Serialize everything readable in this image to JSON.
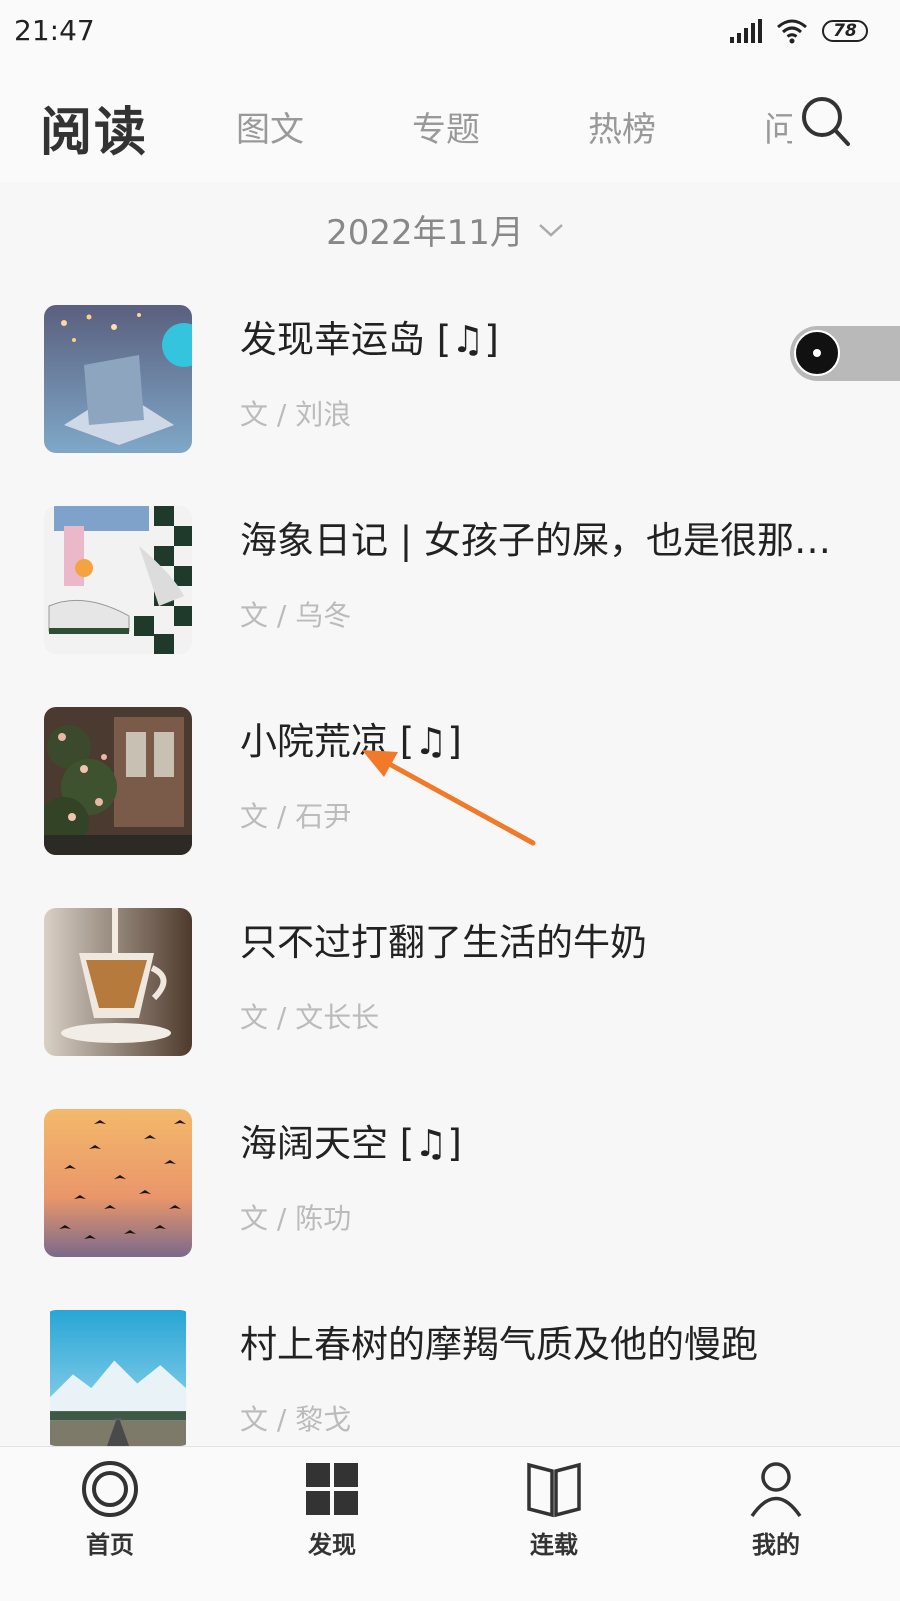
{
  "status_bar": {
    "time": "21:47",
    "battery": "78",
    "icons": [
      "signal-icon",
      "wifi-icon",
      "battery-icon"
    ]
  },
  "header": {
    "title": "阅读",
    "tabs": [
      {
        "label": "图文"
      },
      {
        "label": "专题"
      },
      {
        "label": "热榜"
      },
      {
        "label": "问"
      }
    ],
    "search_icon": "search-icon"
  },
  "month_selector": {
    "label": "2022年11月",
    "icon": "chevron-down-icon"
  },
  "articles": [
    {
      "title": "发现幸运岛 [♫]",
      "author": "文 / 刘浪"
    },
    {
      "title": "海象日记 | 女孩子的屎，也是很那…",
      "author": "文 / 乌冬"
    },
    {
      "title": "小院荒凉 [♫]",
      "author": "文 / 石尹"
    },
    {
      "title": "只不过打翻了生活的牛奶",
      "author": "文 / 文长长"
    },
    {
      "title": "海阔天空 [♫]",
      "author": "文 / 陈功"
    },
    {
      "title": "村上春树的摩羯气质及他的慢跑",
      "author": "文 / 黎戈"
    }
  ],
  "bottom_nav": [
    {
      "label": "首页",
      "icon": "home-icon"
    },
    {
      "label": "发现",
      "icon": "grid-icon"
    },
    {
      "label": "连载",
      "icon": "book-icon"
    },
    {
      "label": "我的",
      "icon": "user-icon"
    }
  ],
  "colors": {
    "annotation_arrow": "#f07a2a",
    "background": "#f7f7f7"
  }
}
